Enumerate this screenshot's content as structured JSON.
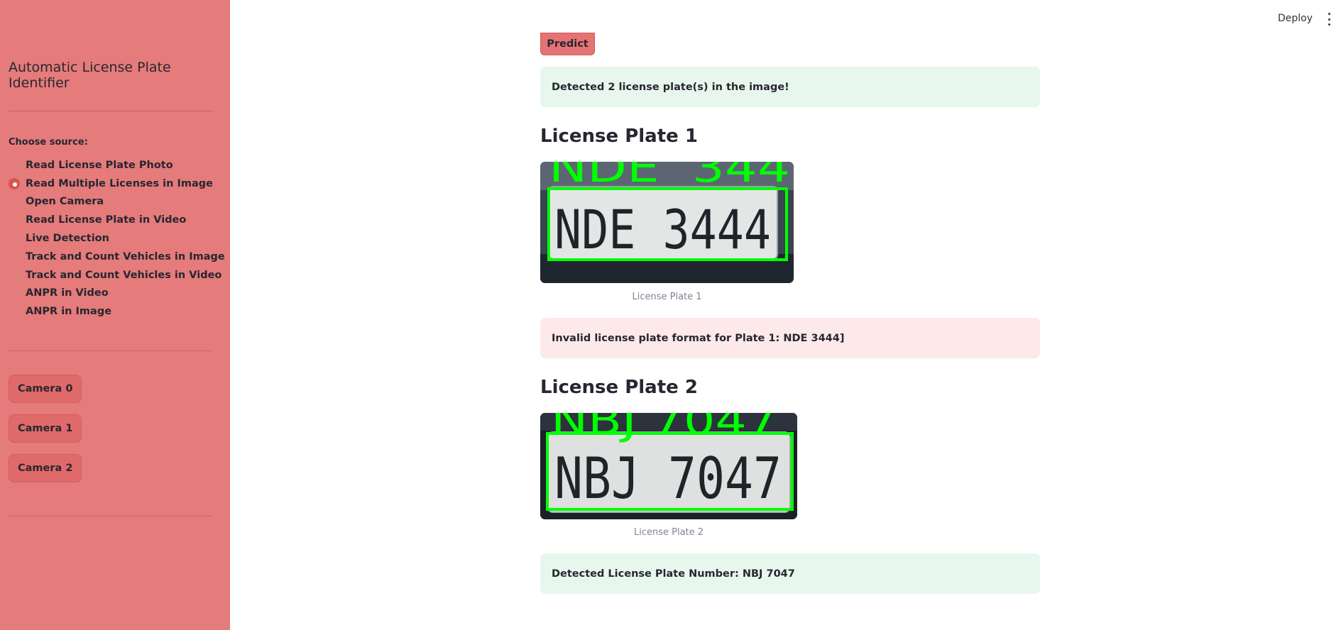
{
  "sidebar": {
    "title": "Automatic License Plate Identifier",
    "source_label": "Choose source:",
    "options": [
      {
        "label": "Read License Plate Photo",
        "selected": false
      },
      {
        "label": "Read Multiple Licenses in Image",
        "selected": true
      },
      {
        "label": "Open Camera",
        "selected": false
      },
      {
        "label": "Read License Plate in Video",
        "selected": false
      },
      {
        "label": "Live Detection",
        "selected": false
      },
      {
        "label": "Track and Count Vehicles in Image",
        "selected": false
      },
      {
        "label": "Track and Count Vehicles in Video",
        "selected": false
      },
      {
        "label": "ANPR in Video",
        "selected": false
      },
      {
        "label": "ANPR in Image",
        "selected": false
      }
    ],
    "buttons": [
      "Camera 0",
      "Camera 1",
      "Camera 2"
    ]
  },
  "header": {
    "deploy_label": "Deploy",
    "menu_icon": "kebab-vertical-icon"
  },
  "main": {
    "predict_label": "Predict",
    "detected_count_msg": "Detected 2 license plate(s) in the image!",
    "plate1": {
      "heading": "License Plate 1",
      "plate_text": "NDE 3444",
      "overlay_text": "NDE  344",
      "caption": "License Plate 1",
      "message": "Invalid license plate format for Plate 1: NDE 3444]"
    },
    "plate2": {
      "heading": "License Plate 2",
      "plate_text": "NBJ 7047",
      "overlay_text": "NBJ 7047",
      "caption": "License Plate 2",
      "message": "Detected License Plate Number: NBJ 7047"
    }
  },
  "colors": {
    "sidebar_bg": "#e57b7b",
    "accent": "#d9534f",
    "success_bg": "#e8f7ed",
    "error_bg": "#fde9ea",
    "detection_box": "#00ff00"
  }
}
